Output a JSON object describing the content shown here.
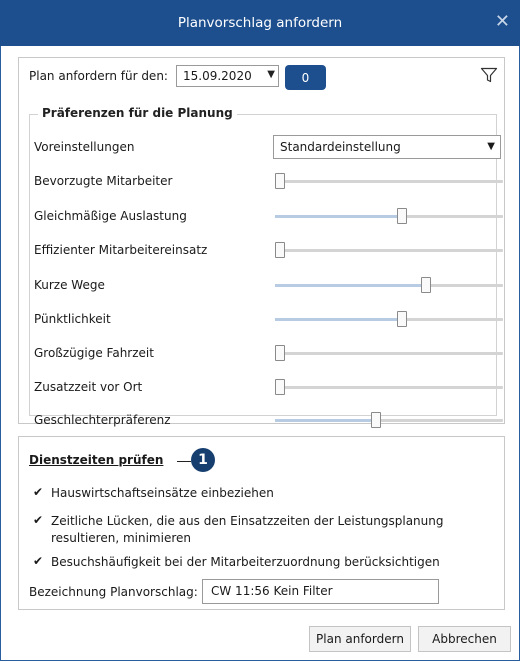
{
  "window": {
    "title": "Planvorschlag anfordern",
    "close_glyph": "✕"
  },
  "plan": {
    "label": "Plan anfordern für den:",
    "date": "15.09.2020",
    "count": "0",
    "filter_icon": "filter-icon"
  },
  "preferences": {
    "group_title": "Präferenzen für die Planung",
    "preset": {
      "label": "Voreinstellungen",
      "value": "Standardeinstellung"
    },
    "sliders": [
      {
        "label": "Bevorzugte Mitarbeiter",
        "level": 0.0
      },
      {
        "label": "Gleichmäßige Auslastung",
        "level": 0.56
      },
      {
        "label": "Effizienter Mitarbeitereinsatz",
        "level": 0.0
      },
      {
        "label": "Kurze Wege",
        "level": 0.67
      },
      {
        "label": "Pünktlichkeit",
        "level": 0.56
      },
      {
        "label": "Großzügige Fahrzeit",
        "level": 0.0
      },
      {
        "label": "Zusatzzeit vor Ort",
        "level": 0.0
      },
      {
        "label": "Geschlechterpräferenz",
        "level": 0.44
      }
    ]
  },
  "dienstzeiten": {
    "title": "Dienstzeiten prüfen",
    "callout": "1",
    "checks": [
      {
        "label": "Hauswirtschaftseinsätze einbeziehen",
        "checked": true
      },
      {
        "label": "Zeitliche Lücken, die aus den Einsatzzeiten der Leistungsplanung resultieren, minimieren",
        "checked": true
      },
      {
        "label": "Besuchshäufigkeit bei der Mitarbeiterzuordnung berücksichtigen",
        "checked": true
      }
    ],
    "name_label": "Bezeichnung Planvorschlag:",
    "name_value": "CW 11:56 Kein Filter"
  },
  "buttons": {
    "request": "Plan anfordern",
    "cancel": "Abbrechen"
  },
  "colors": {
    "titlebar": "#1d4f8f",
    "accent": "#1d4f8f",
    "slider_fill": "#b7cbe3"
  }
}
